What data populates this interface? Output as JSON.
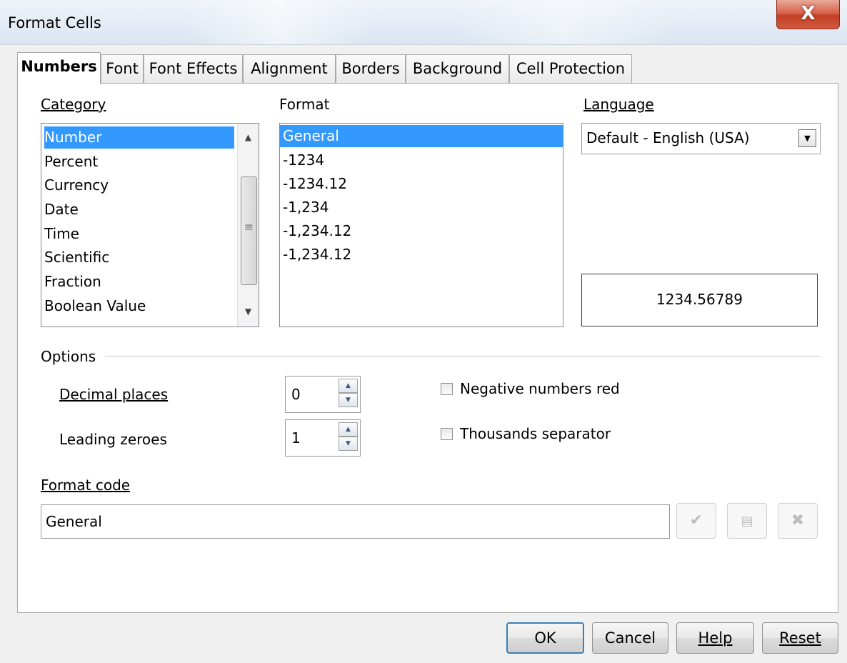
{
  "window": {
    "title": "Format Cells",
    "close_glyph": "X"
  },
  "tabs": [
    {
      "label": "Numbers",
      "active": true
    },
    {
      "label": "Font"
    },
    {
      "label": "Font Effects"
    },
    {
      "label": "Alignment"
    },
    {
      "label": "Borders"
    },
    {
      "label": "Background"
    },
    {
      "label": "Cell Protection"
    }
  ],
  "category": {
    "label": "Category",
    "items": [
      "Number",
      "Percent",
      "Currency",
      "Date",
      "Time",
      "Scientific",
      "Fraction",
      "Boolean Value"
    ],
    "selected": "Number"
  },
  "format": {
    "label": "Format",
    "items": [
      "General",
      "-1234",
      "-1234.12",
      "-1,234",
      "-1,234.12",
      "-1,234.12"
    ],
    "selected": "General"
  },
  "language": {
    "label": "Language",
    "value": "Default - English (USA)"
  },
  "preview": {
    "value": "1234.56789"
  },
  "options": {
    "label": "Options",
    "decimal_places": {
      "label": "Decimal places",
      "value": "0"
    },
    "leading_zeroes": {
      "label": "Leading zeroes",
      "value": "1"
    },
    "negative_red": {
      "label": "Negative numbers red",
      "checked": false
    },
    "thousands_sep": {
      "label": "Thousands separator",
      "checked": false
    }
  },
  "format_code": {
    "label": "Format code",
    "value": "General"
  },
  "buttons": {
    "ok": "OK",
    "cancel": "Cancel",
    "help": "Help",
    "reset": "Reset"
  },
  "colors": {
    "selection": "#3399ff",
    "close_button": "#c94a33",
    "default_button_border": "#3c7fb1"
  },
  "icons": {
    "accept": "checkmark-icon",
    "add_comment": "comment-icon",
    "delete": "delete-x-icon"
  }
}
